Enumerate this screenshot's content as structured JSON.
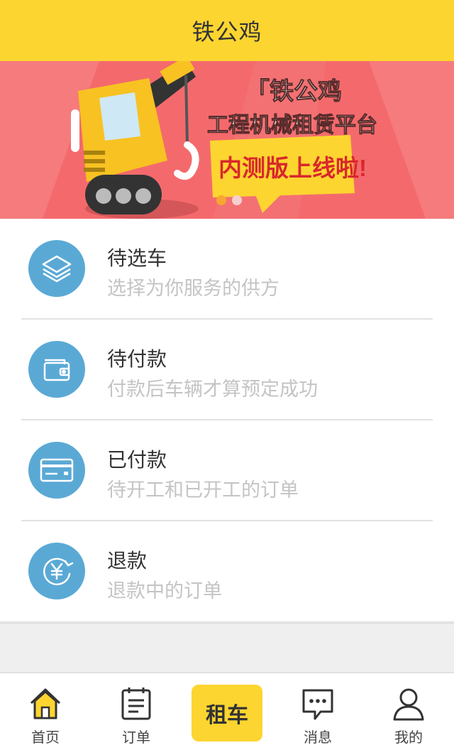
{
  "header": {
    "title": "铁公鸡"
  },
  "banner": {
    "brand": "「铁公鸡",
    "tagline": "工程机械租赁平台",
    "announcement": "内测版上线啦!",
    "dots": 2,
    "active_dot": 0
  },
  "orders": [
    {
      "title": "待选车",
      "subtitle": "选择为你服务的供方",
      "icon": "layers-icon"
    },
    {
      "title": "待付款",
      "subtitle": "付款后车辆才算预定成功",
      "icon": "wallet-icon"
    },
    {
      "title": "已付款",
      "subtitle": "待开工和已开工的订单",
      "icon": "credit-card-icon"
    },
    {
      "title": "退款",
      "subtitle": "退款中的订单",
      "icon": "yuan-refund-icon"
    }
  ],
  "tabbar": {
    "home": "首页",
    "orders": "订单",
    "rent": "租车",
    "messages": "消息",
    "mine": "我的"
  },
  "colors": {
    "accent": "#fdd530",
    "icon_circle": "#5aa9d5",
    "banner_bg": "#f46a6c"
  }
}
